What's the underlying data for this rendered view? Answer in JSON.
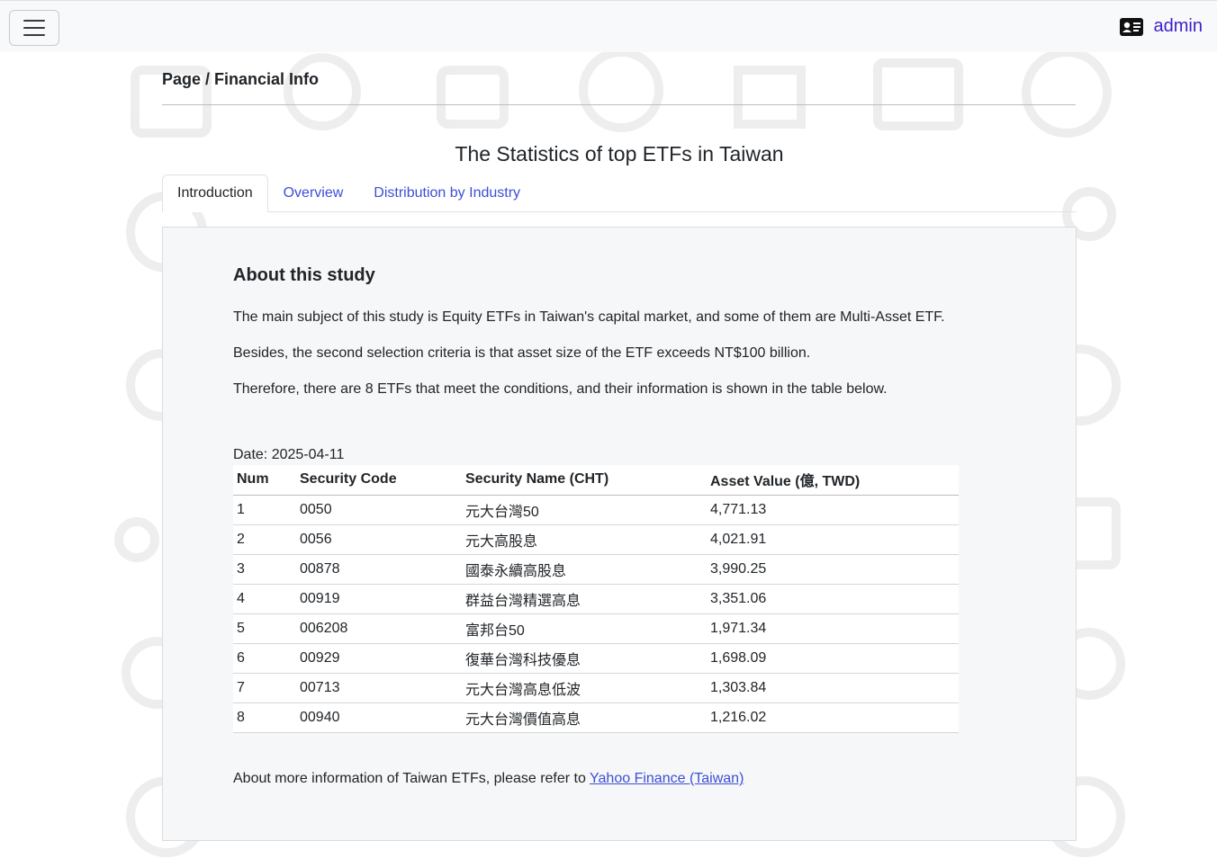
{
  "navbar": {
    "toggle_icon": "hamburger-icon",
    "user_icon": "id-card-icon",
    "user_name": "admin",
    "user_color": "#3d1ec9"
  },
  "breadcrumb": "Page / Financial Info",
  "page_title": "The Statistics of top ETFs in Taiwan",
  "tabs": [
    {
      "label": "Introduction",
      "active": true
    },
    {
      "label": "Overview",
      "active": false
    },
    {
      "label": "Distribution by Industry",
      "active": false
    }
  ],
  "about": {
    "title": "About this study",
    "paragraphs": [
      "The main subject of this study is Equity ETFs in Taiwan's capital market, and some of them are Multi-Asset ETF.",
      "Besides, the second selection criteria is that asset size of the ETF exceeds NT$100 billion.",
      "Therefore, there are 8 ETFs that meet the conditions, and their information is shown in the table below."
    ],
    "date": "Date: 2025-04-11"
  },
  "table": {
    "headers": [
      "Num",
      "Security Code",
      "Security Name (CHT)",
      "Asset Value (億, TWD)"
    ],
    "rows": [
      [
        "1",
        "0050",
        "元大台灣50",
        "4,771.13"
      ],
      [
        "2",
        "0056",
        "元大高股息",
        "4,021.91"
      ],
      [
        "3",
        "00878",
        "國泰永續高股息",
        "3,990.25"
      ],
      [
        "4",
        "00919",
        "群益台灣精選高息",
        "3,351.06"
      ],
      [
        "5",
        "006208",
        "富邦台50",
        "1,971.34"
      ],
      [
        "6",
        "00929",
        "復華台灣科技優息",
        "1,698.09"
      ],
      [
        "7",
        "00713",
        "元大台灣高息低波",
        "1,303.84"
      ],
      [
        "8",
        "00940",
        "元大台灣價值高息",
        "1,216.02"
      ]
    ]
  },
  "footer": {
    "text": "About more information of Taiwan ETFs, please refer to ",
    "link_label": "Yahoo Finance (Taiwan)"
  },
  "colors": {
    "link": "#3d4fd6",
    "panel_bg": "#f6f7f8",
    "navbar_bg": "#f8f9fa"
  }
}
